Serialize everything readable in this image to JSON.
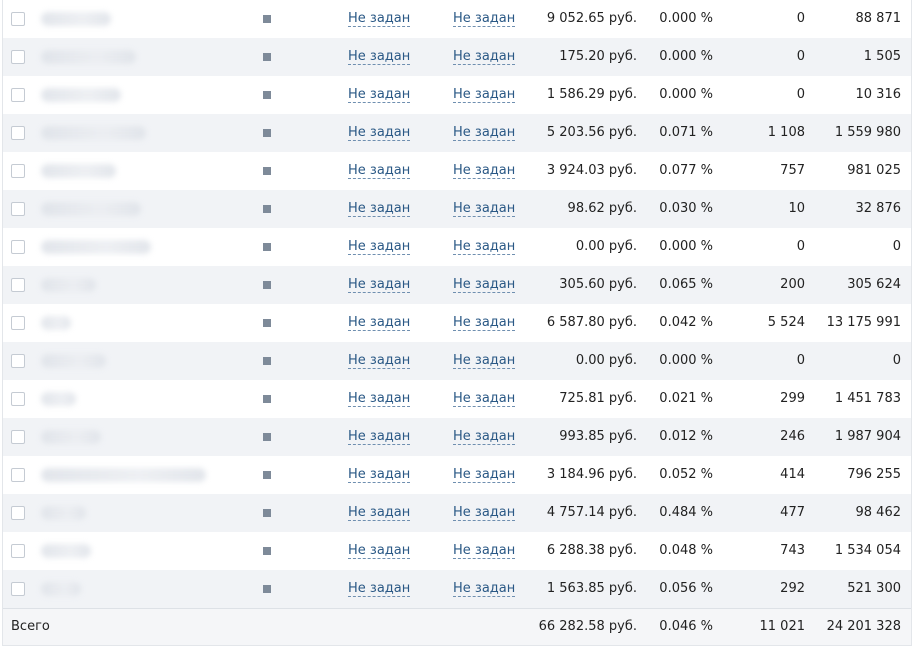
{
  "rows": [
    {
      "status": "Не задан",
      "status2": "Не задан",
      "spend": "9 052.65 руб.",
      "ctr": "0.000 %",
      "clicks": "0",
      "impressions": "88 871"
    },
    {
      "status": "Не задан",
      "status2": "Не задан",
      "spend": "175.20 руб.",
      "ctr": "0.000 %",
      "clicks": "0",
      "impressions": "1 505"
    },
    {
      "status": "Не задан",
      "status2": "Не задан",
      "spend": "1 586.29 руб.",
      "ctr": "0.000 %",
      "clicks": "0",
      "impressions": "10 316"
    },
    {
      "status": "Не задан",
      "status2": "Не задан",
      "spend": "5 203.56 руб.",
      "ctr": "0.071 %",
      "clicks": "1 108",
      "impressions": "1 559 980"
    },
    {
      "status": "Не задан",
      "status2": "Не задан",
      "spend": "3 924.03 руб.",
      "ctr": "0.077 %",
      "clicks": "757",
      "impressions": "981 025"
    },
    {
      "status": "Не задан",
      "status2": "Не задан",
      "spend": "98.62 руб.",
      "ctr": "0.030 %",
      "clicks": "10",
      "impressions": "32 876"
    },
    {
      "status": "Не задан",
      "status2": "Не задан",
      "spend": "0.00 руб.",
      "ctr": "0.000 %",
      "clicks": "0",
      "impressions": "0"
    },
    {
      "status": "Не задан",
      "status2": "Не задан",
      "spend": "305.60 руб.",
      "ctr": "0.065 %",
      "clicks": "200",
      "impressions": "305 624"
    },
    {
      "status": "Не задан",
      "status2": "Не задан",
      "spend": "6 587.80 руб.",
      "ctr": "0.042 %",
      "clicks": "5 524",
      "impressions": "13 175 991"
    },
    {
      "status": "Не задан",
      "status2": "Не задан",
      "spend": "0.00 руб.",
      "ctr": "0.000 %",
      "clicks": "0",
      "impressions": "0"
    },
    {
      "status": "Не задан",
      "status2": "Не задан",
      "spend": "725.81 руб.",
      "ctr": "0.021 %",
      "clicks": "299",
      "impressions": "1 451 783"
    },
    {
      "status": "Не задан",
      "status2": "Не задан",
      "spend": "993.85 руб.",
      "ctr": "0.012 %",
      "clicks": "246",
      "impressions": "1 987 904"
    },
    {
      "status": "Не задан",
      "status2": "Не задан",
      "spend": "3 184.96 руб.",
      "ctr": "0.052 %",
      "clicks": "414",
      "impressions": "796 255"
    },
    {
      "status": "Не задан",
      "status2": "Не задан",
      "spend": "4 757.14 руб.",
      "ctr": "0.484 %",
      "clicks": "477",
      "impressions": "98 462"
    },
    {
      "status": "Не задан",
      "status2": "Не задан",
      "spend": "6 288.38 руб.",
      "ctr": "0.048 %",
      "clicks": "743",
      "impressions": "1 534 054"
    },
    {
      "status": "Не задан",
      "status2": "Не задан",
      "spend": "1 563.85 руб.",
      "ctr": "0.056 %",
      "clicks": "292",
      "impressions": "521 300"
    }
  ],
  "total": {
    "label": "Всего",
    "spend": "66 282.58 руб.",
    "ctr": "0.046 %",
    "clicks": "11 021",
    "impressions": "24 201 328"
  },
  "colors": {
    "link": "#2a5885",
    "row_alt": "#f1f3f6",
    "status_square": "#7e8a99"
  },
  "icons": {
    "row_marker": "status-square-icon",
    "checkbox": "checkbox"
  }
}
